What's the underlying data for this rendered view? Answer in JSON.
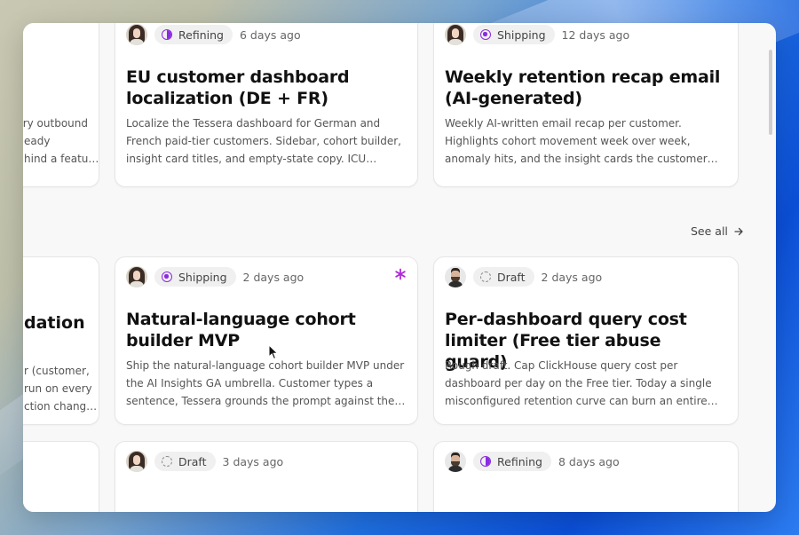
{
  "see_all": {
    "label": "See all",
    "icon": "arrow-right-icon"
  },
  "partial_left": {
    "top_card_lines": [
      "ery outbound",
      "eady",
      "hind a featu…"
    ],
    "mid_card_title": "dation",
    "mid_card_lines": [
      "r (customer,",
      "run on every",
      "ction chang…"
    ]
  },
  "cards": [
    {
      "status": "Refining",
      "status_icon": "refining-icon",
      "age": "6 days ago",
      "title": "EU customer dashboard localization (DE + FR)",
      "description": "Localize the Tessera dashboard for German and French paid-tier customers. Sidebar, cohort builder, insight card titles, and empty-state copy. ICU number…"
    },
    {
      "status": "Shipping",
      "status_icon": "shipping-icon",
      "age": "12 days ago",
      "title": "Weekly retention recap email (AI-generated)",
      "description": "Weekly AI-written email recap per customer. Highlights cohort movement week over week, anomaly hits, and the insight cards the customer clicked into. Honors pe…"
    },
    {
      "status": "Shipping",
      "status_icon": "shipping-icon",
      "age": "2 days ago",
      "title": "Natural-language cohort builder MVP",
      "description": "Ship the natural-language cohort builder MVP under the AI Insights GA umbrella. Customer types a sentence, Tessera grounds the prompt against the…"
    },
    {
      "status": "Draft",
      "status_icon": "draft-icon",
      "age": "2 days ago",
      "title": "Per-dashboard query cost limiter (Free tier abuse guard)",
      "description": "Rough draft. Cap ClickHouse query cost per dashboard per day on the Free tier. Today a single misconfigured retention curve can burn an entire day of customer-tie…"
    },
    {
      "status": "Draft",
      "status_icon": "draft-icon",
      "age": "3 days ago",
      "title": "",
      "description": ""
    },
    {
      "status": "Refining",
      "status_icon": "refining-icon",
      "age": "8 days ago",
      "title": "",
      "description": ""
    }
  ],
  "colors": {
    "accent": "#8a2be2",
    "background": "#f8f8f8",
    "card": "#ffffff"
  }
}
